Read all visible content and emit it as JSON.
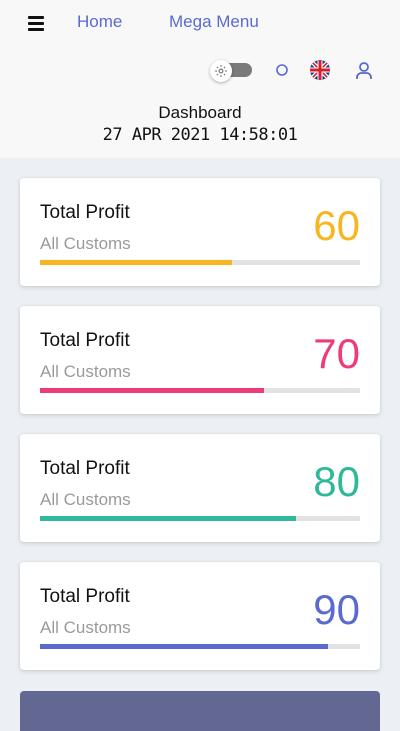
{
  "nav": {
    "menu_icon": "hamburger-icon",
    "links": [
      "Home",
      "Mega Menu"
    ]
  },
  "toolbar": {
    "theme_toggle": {
      "icon": "gear-icon",
      "on": false
    },
    "status_icon": "circle-icon",
    "language_icon": "uk-flag-icon",
    "user_icon": "user-icon"
  },
  "header": {
    "title": "Dashboard",
    "datetime": "27 APR 2021 14:58:01"
  },
  "cards": [
    {
      "title": "Total Profit",
      "subtitle": "All Customs",
      "value": "60",
      "progress": 0.6,
      "color": "#f9b51f"
    },
    {
      "title": "Total Profit",
      "subtitle": "All Customs",
      "value": "70",
      "progress": 0.7,
      "color": "#ee3b7a"
    },
    {
      "title": "Total Profit",
      "subtitle": "All Customs",
      "value": "80",
      "progress": 0.8,
      "color": "#2fb89a"
    },
    {
      "title": "Total Profit",
      "subtitle": "All Customs",
      "value": "90",
      "progress": 0.9,
      "color": "#5b6ad0"
    }
  ],
  "colors": {
    "accent": "#5b6ad0",
    "page_background": "#eceff3",
    "header_background": "#f8f8f9",
    "bottom_panel": "#626891"
  }
}
